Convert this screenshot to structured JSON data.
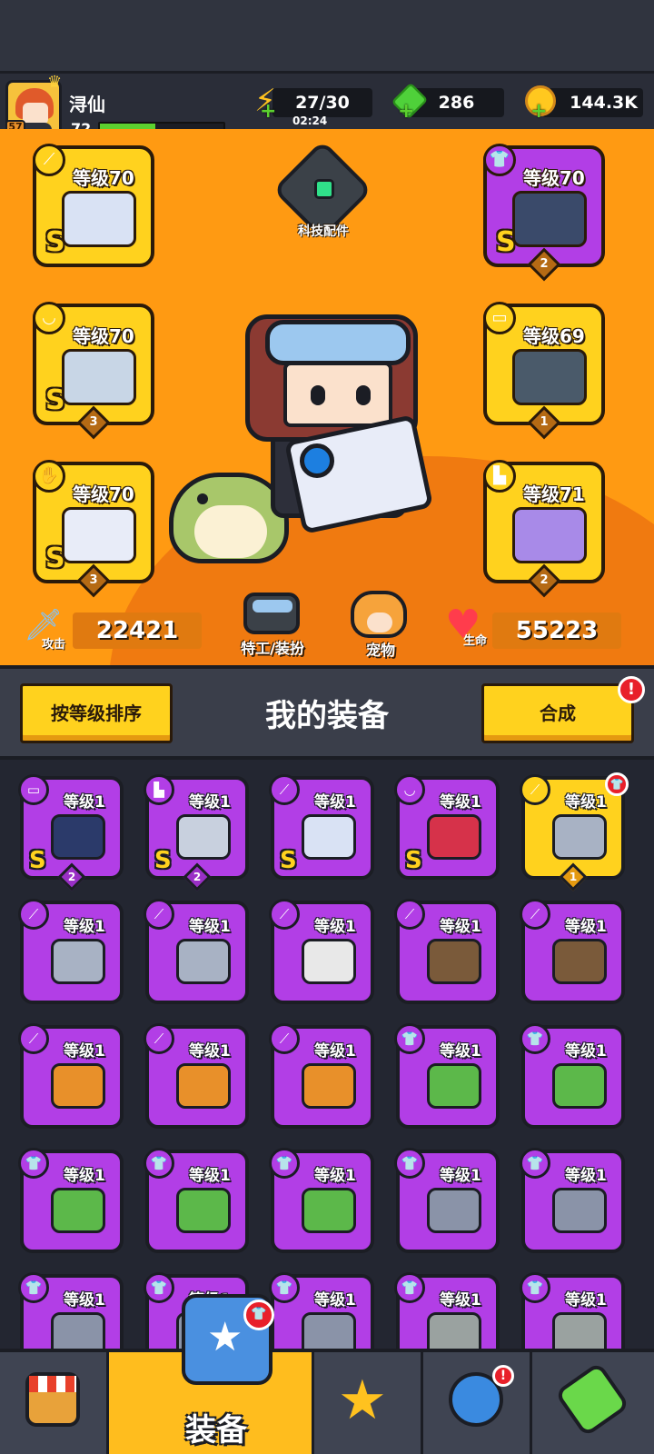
{
  "player": {
    "name": "浔仙",
    "avatar_badge": "57",
    "level": "72",
    "xp_fraction": 0.45
  },
  "resources": {
    "energy": "27/30",
    "energy_timer": "02:24",
    "gems": "286",
    "coins": "144.3K"
  },
  "hero": {
    "tech_part_label": "科技配件",
    "slots": [
      {
        "id": "weapon",
        "level": "等级70",
        "grade": "S",
        "stars": "",
        "frame": "yellow",
        "icon": "knife-icon"
      },
      {
        "id": "armor",
        "level": "等级70",
        "grade": "S",
        "stars": "2",
        "frame": "purple",
        "icon": "shirt-icon"
      },
      {
        "id": "necklace",
        "level": "等级70",
        "grade": "S",
        "stars": "3",
        "frame": "yellow",
        "icon": "necklace-icon"
      },
      {
        "id": "belt",
        "level": "等级69",
        "grade": "",
        "stars": "1",
        "frame": "yellow",
        "icon": "belt-icon"
      },
      {
        "id": "gloves",
        "level": "等级70",
        "grade": "S",
        "stars": "3",
        "frame": "yellow",
        "icon": "glove-icon"
      },
      {
        "id": "boots",
        "level": "等级71",
        "grade": "",
        "stars": "2",
        "frame": "yellow",
        "icon": "boot-icon"
      }
    ],
    "attack_label": "攻击",
    "attack": "22421",
    "costume_label": "特工/装扮",
    "pet_label": "宠物",
    "hp_label": "生命",
    "hp": "55223"
  },
  "equipment": {
    "sort_label": "按等级排序",
    "title": "我的装备",
    "combine_label": "合成",
    "alert": "!",
    "items": [
      {
        "level": "等级1",
        "grade": "S",
        "stars": "2",
        "frame": "purple",
        "cat": "belt-icon",
        "color": "#2b3a6a"
      },
      {
        "level": "等级1",
        "grade": "S",
        "stars": "2",
        "frame": "purple",
        "cat": "boot-icon",
        "color": "#c8d0de"
      },
      {
        "level": "等级1",
        "grade": "S",
        "stars": "",
        "frame": "purple",
        "cat": "knife-icon",
        "color": "#d9e2f4"
      },
      {
        "level": "等级1",
        "grade": "S",
        "stars": "",
        "frame": "purple",
        "cat": "necklace-icon",
        "color": "#d6324a"
      },
      {
        "level": "等级1",
        "grade": "",
        "stars": "1",
        "frame": "yellow",
        "cat": "knife-icon",
        "color": "#a8b2c4",
        "new": true
      },
      {
        "level": "等级1",
        "grade": "",
        "stars": "",
        "frame": "purple",
        "cat": "knife-icon",
        "color": "#a8b2c4"
      },
      {
        "level": "等级1",
        "grade": "",
        "stars": "",
        "frame": "purple",
        "cat": "knife-icon",
        "color": "#a8b2c4"
      },
      {
        "level": "等级1",
        "grade": "",
        "stars": "",
        "frame": "purple",
        "cat": "knife-icon",
        "color": "#e8e8e8"
      },
      {
        "level": "等级1",
        "grade": "",
        "stars": "",
        "frame": "purple",
        "cat": "knife-icon",
        "color": "#7a5a3a"
      },
      {
        "level": "等级1",
        "grade": "",
        "stars": "",
        "frame": "purple",
        "cat": "knife-icon",
        "color": "#7a5a3a"
      },
      {
        "level": "等级1",
        "grade": "",
        "stars": "",
        "frame": "purple",
        "cat": "knife-icon",
        "color": "#e8902a"
      },
      {
        "level": "等级1",
        "grade": "",
        "stars": "",
        "frame": "purple",
        "cat": "knife-icon",
        "color": "#e8902a"
      },
      {
        "level": "等级1",
        "grade": "",
        "stars": "",
        "frame": "purple",
        "cat": "knife-icon",
        "color": "#e8902a"
      },
      {
        "level": "等级1",
        "grade": "",
        "stars": "",
        "frame": "purple",
        "cat": "shirt-icon",
        "color": "#5cb84a"
      },
      {
        "level": "等级1",
        "grade": "",
        "stars": "",
        "frame": "purple",
        "cat": "shirt-icon",
        "color": "#5cb84a"
      },
      {
        "level": "等级1",
        "grade": "",
        "stars": "",
        "frame": "purple",
        "cat": "shirt-icon",
        "color": "#5cb84a"
      },
      {
        "level": "等级1",
        "grade": "",
        "stars": "",
        "frame": "purple",
        "cat": "shirt-icon",
        "color": "#5cb84a"
      },
      {
        "level": "等级1",
        "grade": "",
        "stars": "",
        "frame": "purple",
        "cat": "shirt-icon",
        "color": "#5cb84a"
      },
      {
        "level": "等级1",
        "grade": "",
        "stars": "",
        "frame": "purple",
        "cat": "shirt-icon",
        "color": "#8a93a8"
      },
      {
        "level": "等级1",
        "grade": "",
        "stars": "",
        "frame": "purple",
        "cat": "shirt-icon",
        "color": "#8a93a8"
      },
      {
        "level": "等级1",
        "grade": "",
        "stars": "",
        "frame": "purple",
        "cat": "shirt-icon",
        "color": "#8a93a8"
      },
      {
        "level": "等级1",
        "grade": "",
        "stars": "",
        "frame": "purple",
        "cat": "shirt-icon",
        "color": "#8a93a8"
      },
      {
        "level": "等级1",
        "grade": "",
        "stars": "",
        "frame": "purple",
        "cat": "shirt-icon",
        "color": "#8a93a8"
      },
      {
        "level": "等级1",
        "grade": "",
        "stars": "",
        "frame": "purple",
        "cat": "shirt-icon",
        "color": "#9aa2a0"
      },
      {
        "level": "等级1",
        "grade": "",
        "stars": "",
        "frame": "purple",
        "cat": "shirt-icon",
        "color": "#9aa2a0"
      }
    ]
  },
  "nav": {
    "equip_label": "装备",
    "badge": "!"
  }
}
